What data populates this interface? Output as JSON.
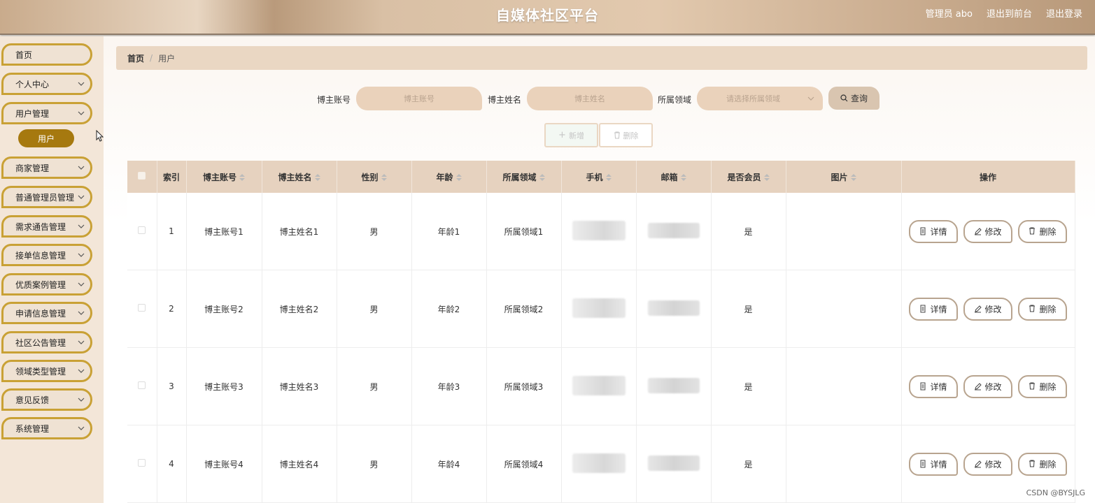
{
  "header": {
    "title": "自媒体社区平台",
    "user": "管理员 abo",
    "front_link": "退出到前台",
    "logout": "退出登录"
  },
  "sidebar": {
    "items": [
      {
        "label": "首页",
        "has_arrow": false
      },
      {
        "label": "个人中心",
        "has_arrow": true
      },
      {
        "label": "用户管理",
        "has_arrow": true
      },
      {
        "label": "商家管理",
        "has_arrow": true
      },
      {
        "label": "普通管理员管理",
        "has_arrow": true
      },
      {
        "label": "需求通告管理",
        "has_arrow": true
      },
      {
        "label": "接单信息管理",
        "has_arrow": true
      },
      {
        "label": "优质案例管理",
        "has_arrow": true
      },
      {
        "label": "申请信息管理",
        "has_arrow": true
      },
      {
        "label": "社区公告管理",
        "has_arrow": true
      },
      {
        "label": "领域类型管理",
        "has_arrow": true
      },
      {
        "label": "意见反馈",
        "has_arrow": true
      },
      {
        "label": "系统管理",
        "has_arrow": true
      }
    ],
    "active_sub": "用户"
  },
  "breadcrumb": {
    "home": "首页",
    "current": "用户"
  },
  "search": {
    "account_label": "博主账号",
    "account_placeholder": "博主账号",
    "name_label": "博主姓名",
    "name_placeholder": "博主姓名",
    "field_label": "所属领域",
    "field_placeholder": "请选择所属领域",
    "query": "查询"
  },
  "actions": {
    "add": "新增",
    "delete": "删除"
  },
  "table": {
    "headers": [
      "索引",
      "博主账号",
      "博主姓名",
      "性别",
      "年龄",
      "所属领域",
      "手机",
      "邮箱",
      "是否会员",
      "图片",
      "操作"
    ],
    "rows": [
      {
        "index": "1",
        "account": "博主账号1",
        "name": "博主姓名1",
        "gender": "男",
        "age": "年龄1",
        "field": "所属领域1",
        "member": "是"
      },
      {
        "index": "2",
        "account": "博主账号2",
        "name": "博主姓名2",
        "gender": "男",
        "age": "年龄2",
        "field": "所属领域2",
        "member": "是"
      },
      {
        "index": "3",
        "account": "博主账号3",
        "name": "博主姓名3",
        "gender": "男",
        "age": "年龄3",
        "field": "所属领域3",
        "member": "是"
      },
      {
        "index": "4",
        "account": "博主账号4",
        "name": "博主姓名4",
        "gender": "男",
        "age": "年龄4",
        "field": "所属领域4",
        "member": "是"
      }
    ],
    "ops": {
      "detail": "详情",
      "edit": "修改",
      "delete": "删除"
    }
  },
  "watermark": "CSDN @BYSJLG",
  "colors": {
    "accent": "#c9a135",
    "active_sub": "#a6790f",
    "header_bg": "#e6d2bf"
  }
}
